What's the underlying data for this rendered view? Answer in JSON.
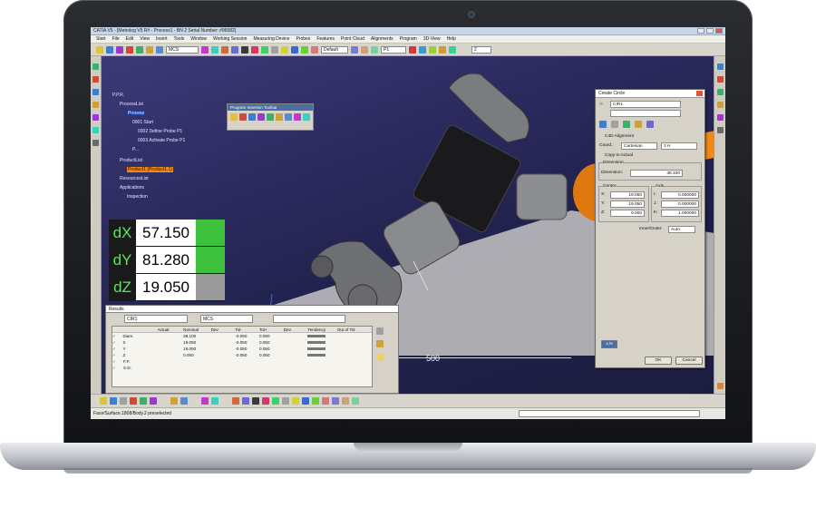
{
  "window": {
    "title": "CATIA V5 - [Metrolog V5 R# - Process1 - BN 2 Serial Number: #96582]"
  },
  "menu": [
    "Start",
    "File",
    "Edit",
    "View",
    "Insert",
    "Tools",
    "Window",
    "Working Session",
    "Measuring Device",
    "Probes",
    "Features",
    "Point Cloud",
    "Alignments",
    "Program",
    "3D-View",
    "Help"
  ],
  "toolbar": {
    "csys_value": "MCS",
    "default_value": "Default",
    "probe_value": "P1",
    "count_value": "2"
  },
  "tree": {
    "root": "P.P.R.",
    "process_list": "ProcessList",
    "process": "Process",
    "op1": "0001 Start",
    "op2": "0002 Define Probe P1",
    "op3": "0003 Activate Probe P1",
    "op4": "P...",
    "product_list": "ProductList",
    "product": "Product1 (Product1.1)",
    "resources": "ResourcesList",
    "applications": "Applications",
    "inspection": "Inspection"
  },
  "dro": [
    {
      "axis": "dX",
      "value": "57.150"
    },
    {
      "axis": "dY",
      "value": "81.280"
    },
    {
      "axis": "dZ",
      "value": "19.050"
    }
  ],
  "program_toolbar": {
    "title": "Program Insertion Toolbar"
  },
  "dimension": {
    "label": "500"
  },
  "results": {
    "title": "Results",
    "feature": "CIR1",
    "csys": "MCS",
    "columns": [
      "Actual",
      "Nominal",
      "Dev",
      "Tol-",
      "Tol+",
      "Dev.",
      "Tendency",
      "Out of Tol."
    ],
    "rows": [
      {
        "name": "Diam.",
        "nominal": "38.100",
        "tolm": "-0.050",
        "tolp": "0.050"
      },
      {
        "name": "X",
        "nominal": "19.050",
        "tolm": "-0.050",
        "tolp": "0.050"
      },
      {
        "name": "Y",
        "nominal": "19.050",
        "tolm": "-0.050",
        "tolp": "0.050"
      },
      {
        "name": "Z",
        "nominal": "0.000",
        "tolm": "-0.050",
        "tolp": "0.050"
      },
      {
        "name": "F.F.",
        "nominal": "",
        "tolm": "",
        "tolp": ""
      },
      {
        "name": "S.D.",
        "nominal": "",
        "tolm": "",
        "tolp": ""
      }
    ]
  },
  "create_circle": {
    "title": "Create Circle",
    "name": "CIR1",
    "c4d_label": "C4D Alignment",
    "coord_label": "Coord.:",
    "coord_value": "Cartesian",
    "coord_unit": "3 H",
    "copy_label": "Copy to Actual",
    "dimension_label": "Dimension",
    "dim_field_label": "Dimension:",
    "dim_value": "38.100",
    "center_label": "Center",
    "axis_label": "Axis",
    "x_label": "X:",
    "y_label": "Y:",
    "z_label": "Z:",
    "i_label": "I:",
    "j_label": "J:",
    "k_label": "K:",
    "cx": "19.050",
    "cy": "19.050",
    "cz": "0.000",
    "ai": "0.000000",
    "aj": "0.000000",
    "ak": "1.000000",
    "inner_outer_label": "Inner/Outer:",
    "inner_outer_value": "Auto",
    "xn_label": "x,N",
    "ok": "OK",
    "cancel": "Cancel"
  },
  "status": {
    "text": "Face/Surface.1808/Body.2 preselected"
  },
  "colors": {
    "viewport": "#2b2a5e",
    "dro_green": "#3ec23e",
    "robot_orange": "#f08a16"
  }
}
